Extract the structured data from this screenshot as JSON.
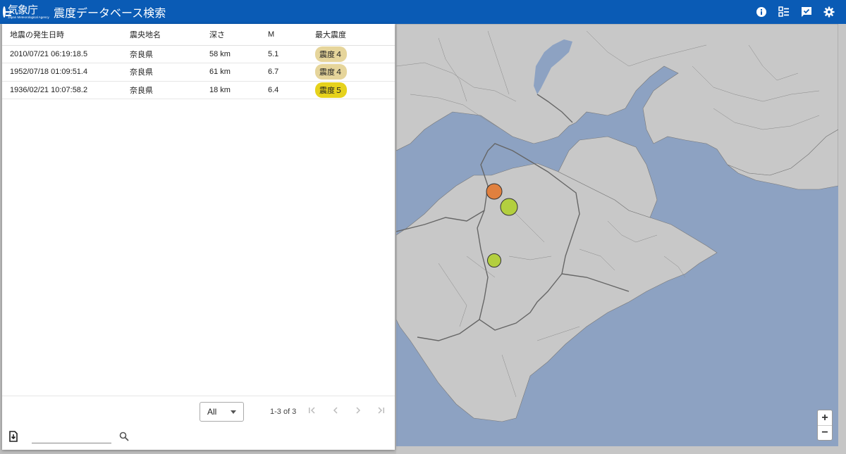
{
  "header": {
    "logo_ja": "気象庁",
    "logo_en": "Japan Meteorological Agency",
    "title": "震度データベース検索",
    "icons": [
      "info-icon",
      "checklist-icon",
      "message-check-icon",
      "settings-icon"
    ],
    "bar_color": "#0a5bb5"
  },
  "table": {
    "columns": [
      "地震の発生日時",
      "震央地名",
      "深さ",
      "M",
      "最大震度"
    ],
    "rows": [
      {
        "datetime": "2010/07/21 06:19:18.5",
        "place": "奈良県",
        "depth": "58 km",
        "mag": "5.1",
        "intensity": "震度４",
        "badge_color": "#e6d59b"
      },
      {
        "datetime": "1952/07/18 01:09:51.4",
        "place": "奈良県",
        "depth": "61 km",
        "mag": "6.7",
        "intensity": "震度４",
        "badge_color": "#e6d59b"
      },
      {
        "datetime": "1936/02/21 10:07:58.2",
        "place": "奈良県",
        "depth": "18 km",
        "mag": "6.4",
        "intensity": "震度５",
        "badge_color": "#e6d21c"
      }
    ]
  },
  "footer": {
    "rows_per_page": "All",
    "range_text": "1-3 of 3"
  },
  "search": {
    "placeholder": ""
  },
  "map": {
    "zoom_in": "+",
    "zoom_out": "−",
    "sea_color": "#8da2c2",
    "land_color": "#c8c8c8",
    "markers": [
      {
        "color": "#e0803f"
      },
      {
        "color": "#b3cf3f"
      },
      {
        "color": "#b3cf3f"
      }
    ]
  }
}
